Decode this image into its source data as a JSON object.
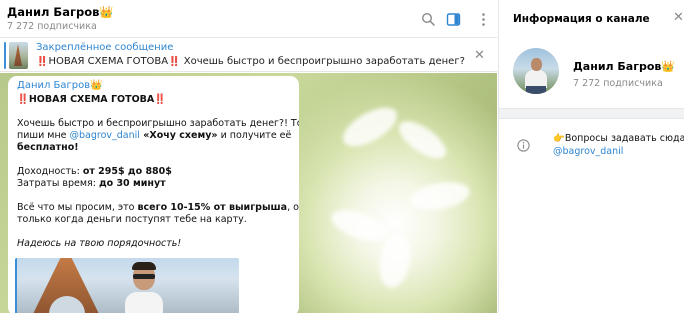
{
  "chat": {
    "title": "Данил Багров👑",
    "subscribers": "7 272 подписчика",
    "icons": [
      "search-icon",
      "side-panel-icon",
      "more-icon"
    ]
  },
  "pinned": {
    "label": "Закреплённое сообщение",
    "text": "‼️НОВАЯ СХЕМА ГОТОВА‼️  Хочешь быстро и беспроигрышно заработать денег?! Тогда пиши..."
  },
  "message": {
    "author": "Данил Багров👑",
    "headline": "‼️НОВАЯ СХЕМА ГОТОВА‼️",
    "p1_line1": "Хочешь быстро и беспроигрышно заработать денег?! Тогда",
    "p1_line2_pre": "пиши мне ",
    "p1_link": "@bagrov_danil",
    "p1_bold": " «Хочу схему»",
    "p1_line2_post": " и получите её",
    "p1_line3": "бесплатно!",
    "income_label": "Доходность: ",
    "income_value": "от 295$ до 880$",
    "time_label": "Затраты время: ",
    "time_value": "до 30 минут",
    "p3_line1_pre": "Всё что мы просим, это ",
    "p3_line1_bold": "всего 10-15% от выигрыша",
    "p3_line1_post": ", отдаёшь",
    "p3_line2": "только когда деньги поступят тебе на карту.",
    "closing": "Надеюсь на твою порядочность!"
  },
  "info": {
    "title": "Информация о канале",
    "name": "Данил Багров👑",
    "subscribers": "7 272 подписчика",
    "description": "👉Вопросы задавать сюда:",
    "link": "@bagrov_danil"
  },
  "colors": {
    "accent": "#2f85d0",
    "muted": "#8a8a8a"
  }
}
